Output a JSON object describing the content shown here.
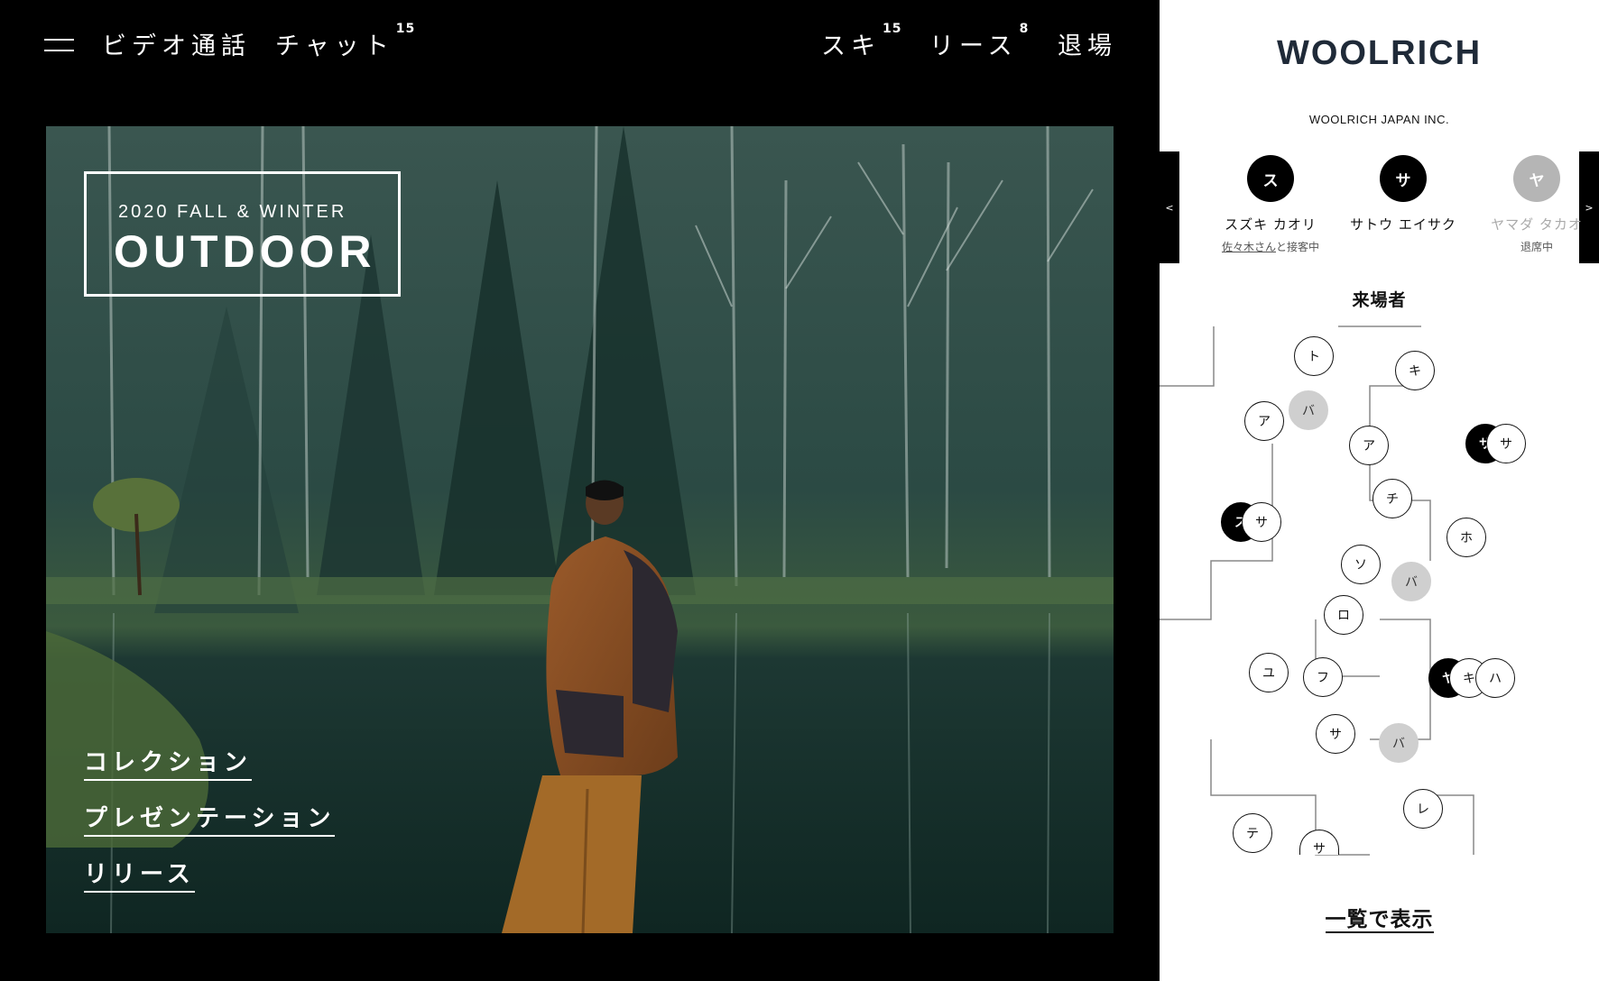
{
  "topbar": {
    "video_call": "ビデオ通話",
    "chat": "チャット",
    "chat_count": "15",
    "like": "スキ",
    "like_count": "15",
    "release": "リース",
    "release_count": "8",
    "exit": "退場"
  },
  "hero": {
    "season": "2020 FALL & WINTER",
    "title": "OUTDOOR",
    "links": [
      "コレクション",
      "プレゼンテーション",
      "リリース"
    ]
  },
  "sidebar": {
    "brand": "WOOLRICH",
    "company": "WOOLRICH JAPAN INC.",
    "prev_tab": "<",
    "next_tab": ">",
    "staff": [
      {
        "initial": "ス",
        "name": "スズキ カオリ",
        "status_link": "佐々木さん",
        "status_text": "と接客中",
        "state": "busy"
      },
      {
        "initial": "サ",
        "name": "サトウ エイサク",
        "status_link": "",
        "status_text": "",
        "state": "available"
      },
      {
        "initial": "ヤ",
        "name": "ヤマダ タカオ",
        "status_link": "",
        "status_text": "退席中",
        "state": "away"
      }
    ],
    "visitors_title": "来場者",
    "visitors": [
      {
        "label": "ト",
        "style": "outline"
      },
      {
        "label": "キ",
        "style": "outline"
      },
      {
        "label": "ア",
        "style": "outline"
      },
      {
        "label": "バ",
        "style": "gray"
      },
      {
        "label": "ア",
        "style": "outline"
      },
      {
        "label": "サ",
        "style": "dark"
      },
      {
        "label": "サ",
        "style": "outline"
      },
      {
        "label": "チ",
        "style": "outline"
      },
      {
        "label": "ス",
        "style": "dark"
      },
      {
        "label": "サ",
        "style": "outline"
      },
      {
        "label": "ホ",
        "style": "outline"
      },
      {
        "label": "ソ",
        "style": "outline"
      },
      {
        "label": "バ",
        "style": "gray"
      },
      {
        "label": "ロ",
        "style": "outline"
      },
      {
        "label": "ユ",
        "style": "outline"
      },
      {
        "label": "フ",
        "style": "outline"
      },
      {
        "label": "ヤ",
        "style": "dark"
      },
      {
        "label": "キ",
        "style": "outline"
      },
      {
        "label": "ハ",
        "style": "outline"
      },
      {
        "label": "サ",
        "style": "outline"
      },
      {
        "label": "バ",
        "style": "gray"
      },
      {
        "label": "レ",
        "style": "outline"
      },
      {
        "label": "テ",
        "style": "outline"
      },
      {
        "label": "サ",
        "style": "outline"
      }
    ],
    "list_link": "一覧で表示"
  }
}
